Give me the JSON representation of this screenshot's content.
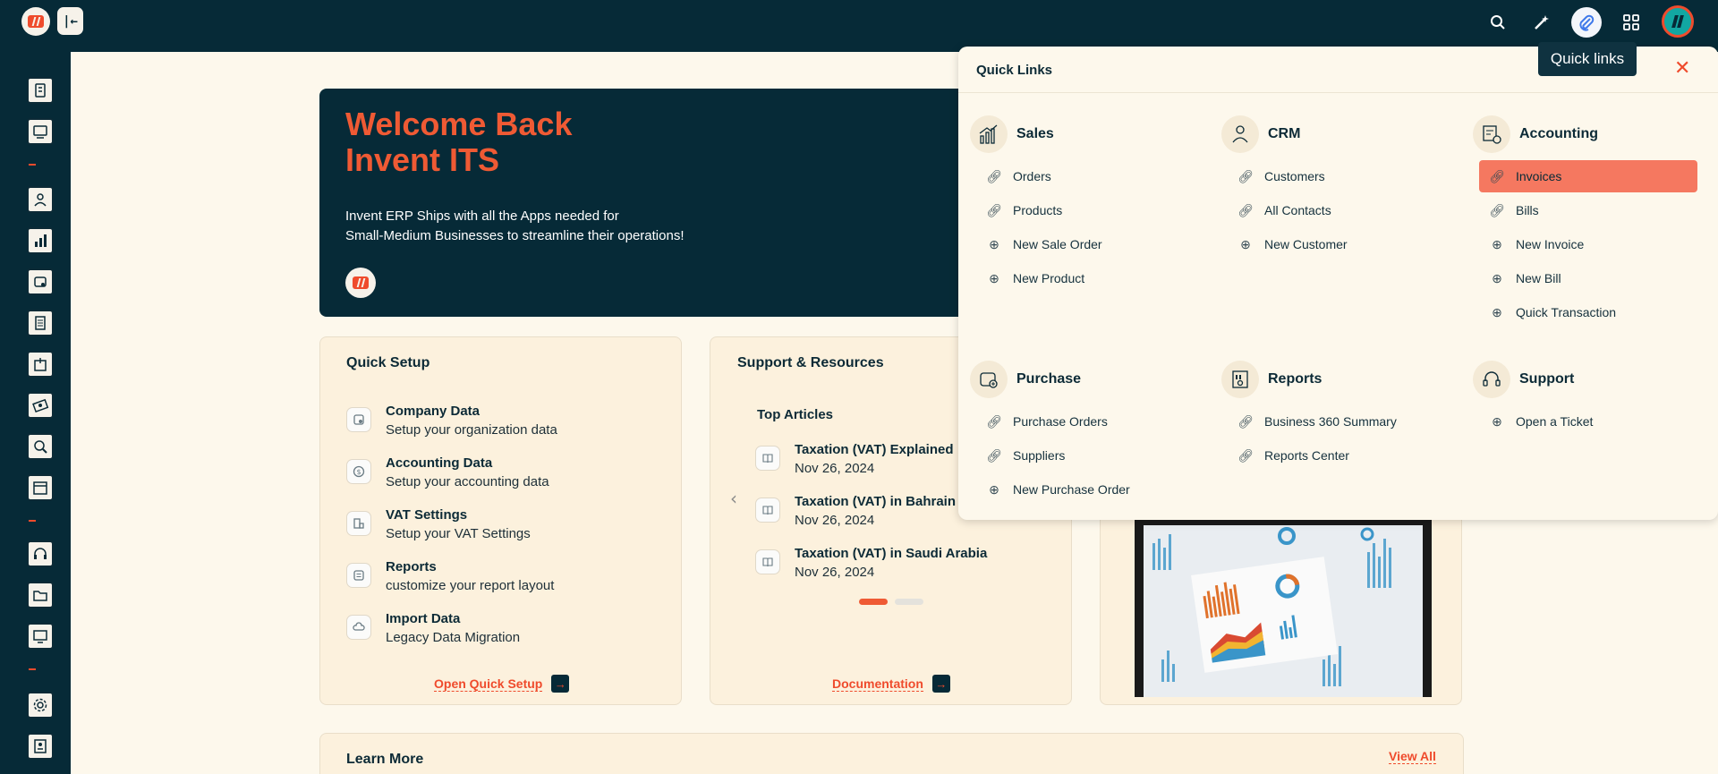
{
  "header": {
    "tooltip": "Quick links"
  },
  "welcome": {
    "title_line1": "Welcome Back",
    "title_line2": "Invent ITS",
    "text_line1": "Invent ERP Ships with all the Apps needed for",
    "text_line2": "Small-Medium Businesses to streamline their operations!"
  },
  "quick_setup": {
    "title": "Quick Setup",
    "items": [
      {
        "title": "Company Data",
        "desc": "Setup your organization data",
        "icon": "building-icon"
      },
      {
        "title": "Accounting Data",
        "desc": "Setup your accounting data",
        "icon": "dollar-icon"
      },
      {
        "title": "VAT Settings",
        "desc": "Setup your VAT Settings",
        "icon": "vat-icon"
      },
      {
        "title": "Reports",
        "desc": "customize your report layout",
        "icon": "report-icon"
      },
      {
        "title": "Import Data",
        "desc": "Legacy Data Migration",
        "icon": "cloud-icon"
      }
    ],
    "link": "Open Quick Setup"
  },
  "support": {
    "title": "Support & Resources",
    "subtitle": "Top Articles",
    "articles": [
      {
        "title": "Taxation (VAT) Explained",
        "date": "Nov 26, 2024"
      },
      {
        "title": "Taxation (VAT) in Bahrain",
        "date": "Nov 26, 2024"
      },
      {
        "title": "Taxation (VAT) in Saudi Arabia",
        "date": "Nov 26, 2024"
      }
    ],
    "link": "Documentation"
  },
  "learn_more": {
    "title": "Learn More",
    "link": "View All"
  },
  "quick_links": {
    "title": "Quick Links",
    "groups": [
      {
        "name": "Sales",
        "icon": "sales-chart-icon",
        "items": [
          {
            "label": "Orders",
            "icon": "link-icon"
          },
          {
            "label": "Products",
            "icon": "link-icon"
          },
          {
            "label": "New Sale Order",
            "icon": "plus-icon"
          },
          {
            "label": "New Product",
            "icon": "plus-icon"
          }
        ]
      },
      {
        "name": "CRM",
        "icon": "crm-icon",
        "items": [
          {
            "label": "Customers",
            "icon": "link-icon"
          },
          {
            "label": "All Contacts",
            "icon": "link-icon"
          },
          {
            "label": "New Customer",
            "icon": "plus-icon"
          }
        ]
      },
      {
        "name": "Accounting",
        "icon": "accounting-icon",
        "items": [
          {
            "label": "Invoices",
            "icon": "link-icon",
            "active": true
          },
          {
            "label": "Bills",
            "icon": "link-icon"
          },
          {
            "label": "New Invoice",
            "icon": "plus-icon"
          },
          {
            "label": "New Bill",
            "icon": "plus-icon"
          },
          {
            "label": "Quick Transaction",
            "icon": "plus-icon"
          }
        ]
      },
      {
        "name": "Purchase",
        "icon": "purchase-icon",
        "items": [
          {
            "label": "Purchase Orders",
            "icon": "link-icon"
          },
          {
            "label": "Suppliers",
            "icon": "link-icon"
          },
          {
            "label": "New Purchase Order",
            "icon": "plus-icon"
          }
        ]
      },
      {
        "name": "Reports",
        "icon": "reports-icon",
        "items": [
          {
            "label": "Business 360 Summary",
            "icon": "link-icon"
          },
          {
            "label": "Reports Center",
            "icon": "link-icon"
          }
        ]
      },
      {
        "name": "Support",
        "icon": "headset-icon",
        "items": [
          {
            "label": "Open a Ticket",
            "icon": "plus-icon"
          }
        ]
      }
    ]
  },
  "colors": {
    "navy": "#062a37",
    "accent": "#ef4b2c",
    "card": "#fcf1dd",
    "background": "#fdf8ec",
    "active_item": "#f57860"
  }
}
